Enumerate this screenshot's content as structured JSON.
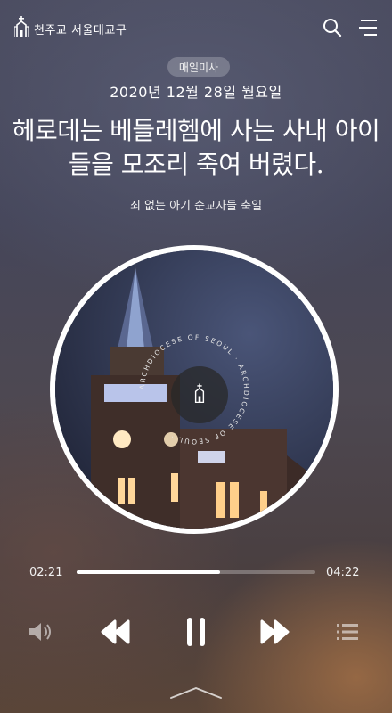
{
  "header": {
    "logo_text": "천주교 서울대교구",
    "logo_icon": "cathedral-icon",
    "search_icon": "search-icon",
    "menu_icon": "menu-icon"
  },
  "category_badge": "매일미사",
  "date": "2020년 12월 28일 월요일",
  "headline": "헤로데는 베들레헴에 사는 사내 아이들을 모조리 죽여 버렸다.",
  "subtitle": "죄 없는 아기 순교자들 축일",
  "disc": {
    "ring_text": "ARCHDIOCESE OF SEOUL · ARCHDIOCESE OF SEOUL ·",
    "center_icon": "cathedral-icon"
  },
  "player": {
    "current_time": "02:21",
    "total_time": "04:22",
    "progress": 0.6,
    "colors": {
      "fill": "#ffffff",
      "track": "rgba(255,255,255,0.28)"
    }
  },
  "controls": {
    "volume_icon": "volume-icon",
    "prev_icon": "rewind-icon",
    "pause_icon": "pause-icon",
    "next_icon": "fast-forward-icon",
    "playlist_icon": "playlist-icon",
    "expand_icon": "chevron-up-icon"
  }
}
